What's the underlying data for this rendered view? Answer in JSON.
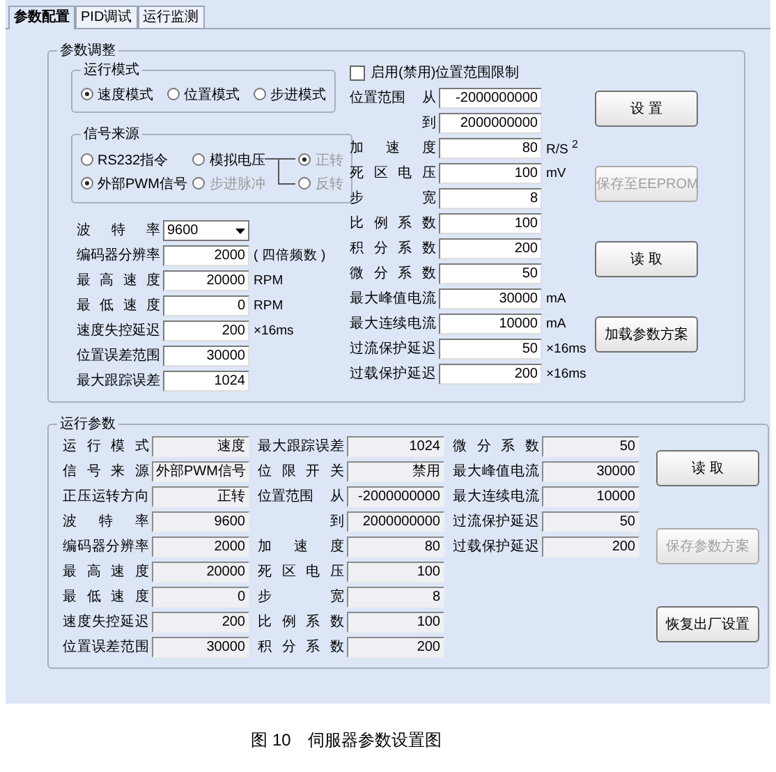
{
  "tabs": [
    {
      "label": "参数配置",
      "selected": true
    },
    {
      "label": "PID调试",
      "selected": false
    },
    {
      "label": "运行监测",
      "selected": false
    }
  ],
  "settings": {
    "title": "参数调整",
    "mode": {
      "title": "运行模式",
      "options": [
        {
          "label": "速度模式",
          "selected": true
        },
        {
          "label": "位置模式",
          "selected": false
        },
        {
          "label": "步进模式",
          "selected": false
        }
      ]
    },
    "signal": {
      "title": "信号来源",
      "options": [
        {
          "label": "RS232指令",
          "selected": false,
          "disabled": false
        },
        {
          "label": "模拟电压",
          "selected": false,
          "disabled": false
        },
        {
          "label": "外部PWM信号",
          "selected": true,
          "disabled": false
        },
        {
          "label": "步进脉冲",
          "selected": false,
          "disabled": true
        }
      ],
      "direction": [
        {
          "label": "正转",
          "selected": true,
          "disabled": true
        },
        {
          "label": "反转",
          "selected": false,
          "disabled": true
        }
      ]
    },
    "left_fields": [
      {
        "kind": "dropdown",
        "label": "波特率",
        "value": "9600"
      },
      {
        "kind": "input",
        "label": "编码器分辨率",
        "value": "2000",
        "unit": "( 四倍频数 )"
      },
      {
        "kind": "input",
        "label": "最高速度",
        "value": "20000",
        "unit": "RPM"
      },
      {
        "kind": "input",
        "label": "最低速度",
        "value": "0",
        "unit": "RPM"
      },
      {
        "kind": "input",
        "label": "速度失控延迟",
        "value": "200",
        "unit": "×16ms"
      },
      {
        "kind": "input",
        "label": "位置误差范围",
        "value": "30000"
      },
      {
        "kind": "input",
        "label": "最大跟踪误差",
        "value": "1024"
      }
    ],
    "range_limit": {
      "label": "启用(禁用)位置范围限制",
      "checked": false
    },
    "right_fields": [
      {
        "label": "位置范围",
        "prefix": "从",
        "value": "-2000000000"
      },
      {
        "prefix": "到",
        "value": "2000000000"
      },
      {
        "label": "加速度",
        "value": "80",
        "unit": "R/S $^{2}$"
      },
      {
        "label": "死区电压",
        "value": "100",
        "unit": "mV"
      },
      {
        "label": "步宽",
        "value": "8"
      },
      {
        "label": "比例系数",
        "value": "100"
      },
      {
        "label": "积分系数",
        "value": "200"
      },
      {
        "label": "微分系数",
        "value": "50"
      },
      {
        "label": "最大峰值电流",
        "value": "30000",
        "unit": "mA"
      },
      {
        "label": "最大连续电流",
        "value": "10000",
        "unit": "mA"
      },
      {
        "label": "过流保护延迟",
        "value": "50",
        "unit": "×16ms"
      },
      {
        "label": "过载保护延迟",
        "value": "200",
        "unit": "×16ms"
      }
    ],
    "buttons": [
      {
        "label": "设 置",
        "disabled": false
      },
      {
        "label": "保存至EEPROM",
        "disabled": true
      },
      {
        "label": "读 取",
        "disabled": false
      },
      {
        "label": "加载参数方案",
        "disabled": false
      }
    ]
  },
  "monitor": {
    "title": "运行参数",
    "columns": [
      [
        {
          "label": "运行模式",
          "value": "速度"
        },
        {
          "label": "信号来源",
          "value": "外部PWM信号"
        },
        {
          "label": "正压运转方向",
          "value": "正转"
        },
        {
          "label": "波特率",
          "value": "9600"
        },
        {
          "label": "编码器分辨率",
          "value": "2000"
        },
        {
          "label": "最高速度",
          "value": "20000"
        },
        {
          "label": "最低速度",
          "value": "0"
        },
        {
          "label": "速度失控延迟",
          "value": "200"
        },
        {
          "label": "位置误差范围",
          "value": "30000"
        }
      ],
      [
        {
          "label": "最大跟踪误差",
          "value": "1024"
        },
        {
          "label": "位限开关",
          "value": "禁用"
        },
        {
          "label": "位置范围",
          "prefix": "从",
          "value": "-2000000000"
        },
        {
          "prefix": "到",
          "value": "2000000000"
        },
        {
          "label": "加速度",
          "value": "80"
        },
        {
          "label": "死区电压",
          "value": "100"
        },
        {
          "label": "步宽",
          "value": "8"
        },
        {
          "label": "比例系数",
          "value": "100"
        },
        {
          "label": "积分系数",
          "value": "200"
        }
      ],
      [
        {
          "label": "微分系数",
          "value": "50"
        },
        {
          "label": "最大峰值电流",
          "value": "30000"
        },
        {
          "label": "最大连续电流",
          "value": "10000"
        },
        {
          "label": "过流保护延迟",
          "value": "50"
        },
        {
          "label": "过载保护延迟",
          "value": "200"
        }
      ]
    ],
    "buttons": [
      {
        "label": "读 取",
        "disabled": false
      },
      {
        "label": "保存参数方案",
        "disabled": true
      },
      {
        "label": "恢复出厂设置",
        "disabled": false
      }
    ]
  },
  "caption": "图 10　伺服器参数设置图"
}
